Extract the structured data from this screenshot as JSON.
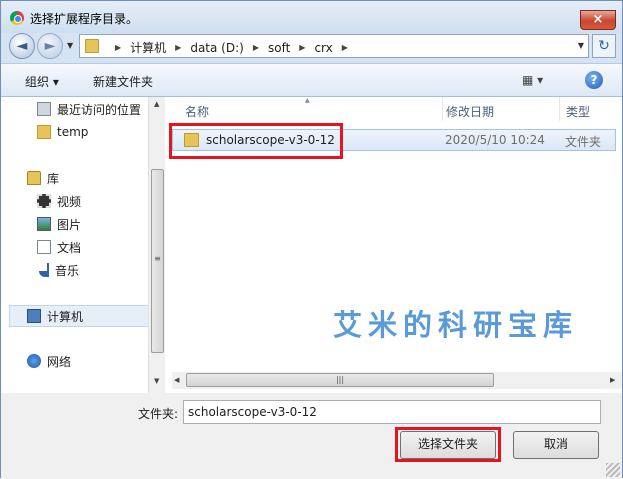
{
  "window": {
    "title": "选择扩展程序目录。",
    "close_label": "×"
  },
  "nav": {
    "back_glyph": "◄",
    "forward_glyph": "►",
    "breadcrumb": [
      "计算机",
      "data (D:)",
      "soft",
      "crx"
    ],
    "refresh_glyph": "↻"
  },
  "toolbar": {
    "organize_label": "组织 ▾",
    "new_folder_label": "新建文件夹",
    "view_glyph": "▦ ▾",
    "help_label": "?"
  },
  "sidebar": {
    "items": [
      {
        "label": "最近访问的位置",
        "icon": "recent-places-icon"
      },
      {
        "label": "temp",
        "icon": "folder-icon"
      },
      {
        "label": "库",
        "icon": "library-icon"
      },
      {
        "label": "视频",
        "icon": "video-icon"
      },
      {
        "label": "图片",
        "icon": "pictures-icon"
      },
      {
        "label": "文档",
        "icon": "documents-icon"
      },
      {
        "label": "音乐",
        "icon": "music-icon"
      },
      {
        "label": "计算机",
        "icon": "computer-icon"
      },
      {
        "label": "网络",
        "icon": "network-icon"
      }
    ],
    "selected": "计算机"
  },
  "file_list": {
    "columns": [
      "名称",
      "修改日期",
      "类型"
    ],
    "rows": [
      {
        "name": "scholarscope-v3-0-12",
        "date": "2020/5/10 10:24",
        "type": "文件夹"
      }
    ]
  },
  "watermark": "艾米的科研宝库",
  "footer": {
    "filename_label": "文件夹:",
    "filename_value": "scholarscope-v3-0-12",
    "select_button": "选择文件夹",
    "cancel_button": "取消"
  },
  "colors": {
    "highlight": "#e4151f",
    "watermark": "#5b9ad8",
    "selection": "#dbe8f8"
  }
}
